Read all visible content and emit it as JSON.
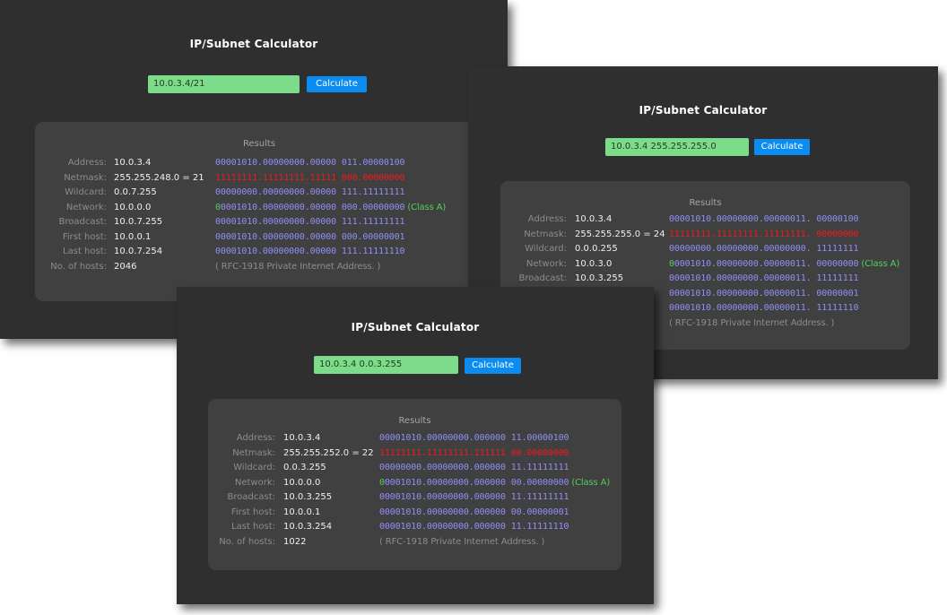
{
  "windows": [
    {
      "title": "IP/Subnet Calculator",
      "input_value": "10.0.3.4/21",
      "button_label": "Calculate",
      "results": {
        "title": "Results",
        "rows": [
          {
            "label": "Address:",
            "value": "10.0.3.4",
            "bin": "00001010.00000000.00000 011.00000100"
          },
          {
            "label": "Netmask:",
            "value": "255.255.248.0 = 21",
            "bin": "11111111.11111111.11111 000.00000000"
          },
          {
            "label": "Wildcard:",
            "value": "0.0.7.255",
            "bin": "00000000.00000000.00000 111.11111111"
          },
          {
            "label": "Network:",
            "value": "10.0.0.0",
            "bin_lead": "0",
            "bin_rest": "0001010.00000000.00000 000.00000000",
            "class": "(Class A)"
          },
          {
            "label": "Broadcast:",
            "value": "10.0.7.255",
            "bin": "00001010.00000000.00000 111.11111111"
          },
          {
            "label": "First host:",
            "value": "10.0.0.1",
            "bin": "00001010.00000000.00000 000.00000001"
          },
          {
            "label": "Last host:",
            "value": "10.0.7.254",
            "bin": "00001010.00000000.00000 111.11111110"
          },
          {
            "label": "No. of hosts:",
            "value": "2046",
            "note": "( RFC-1918 Private Internet Address. )"
          }
        ]
      }
    },
    {
      "title": "IP/Subnet Calculator",
      "input_value": "10.0.3.4 255.255.255.0",
      "button_label": "Calculate",
      "results": {
        "title": "Results",
        "rows": [
          {
            "label": "Address:",
            "value": "10.0.3.4",
            "bin": "00001010.00000000.00000011. 00000100"
          },
          {
            "label": "Netmask:",
            "value": "255.255.255.0 = 24",
            "bin": "11111111.11111111.11111111. 00000000"
          },
          {
            "label": "Wildcard:",
            "value": "0.0.0.255",
            "bin": "00000000.00000000.00000000. 11111111"
          },
          {
            "label": "Network:",
            "value": "10.0.3.0",
            "bin_lead": "0",
            "bin_rest": "0001010.00000000.00000011. 00000000",
            "class": "(Class A)"
          },
          {
            "label": "Broadcast:",
            "value": "10.0.3.255",
            "bin": "00001010.00000000.00000011. 11111111"
          },
          {
            "label": "",
            "value": "",
            "bin": "00001010.00000000.00000011. 00000001"
          },
          {
            "label": "",
            "value": "",
            "bin": "00001010.00000000.00000011. 11111110"
          },
          {
            "label": "",
            "value": "",
            "note": "( RFC-1918 Private Internet Address. )"
          }
        ]
      }
    },
    {
      "title": "IP/Subnet Calculator",
      "input_value": "10.0.3.4 0.0.3.255",
      "button_label": "Calculate",
      "results": {
        "title": "Results",
        "rows": [
          {
            "label": "Address:",
            "value": "10.0.3.4",
            "bin": "00001010.00000000.000000 11.00000100"
          },
          {
            "label": "Netmask:",
            "value": "255.255.252.0 = 22",
            "bin": "11111111.11111111.111111 00.00000000"
          },
          {
            "label": "Wildcard:",
            "value": "0.0.3.255",
            "bin": "00000000.00000000.000000 11.11111111"
          },
          {
            "label": "Network:",
            "value": "10.0.0.0",
            "bin_lead": "0",
            "bin_rest": "0001010.00000000.000000 00.00000000",
            "class": "(Class A)"
          },
          {
            "label": "Broadcast:",
            "value": "10.0.3.255",
            "bin": "00001010.00000000.000000 11.11111111"
          },
          {
            "label": "First host:",
            "value": "10.0.0.1",
            "bin": "00001010.00000000.000000 00.00000001"
          },
          {
            "label": "Last host:",
            "value": "10.0.3.254",
            "bin": "00001010.00000000.000000 11.11111110"
          },
          {
            "label": "No. of hosts:",
            "value": "1022",
            "note": "( RFC-1918 Private Internet Address. )"
          }
        ]
      }
    }
  ],
  "colors": {
    "window_bg": "#2f2f2f",
    "results_bg": "#404040",
    "input_bg": "#7ddc8a",
    "button_bg": "#0a8cf0",
    "binary": "#8f8ff5",
    "netmask_binary": "#ee1b1b",
    "class_accent": "#4fd05a"
  }
}
